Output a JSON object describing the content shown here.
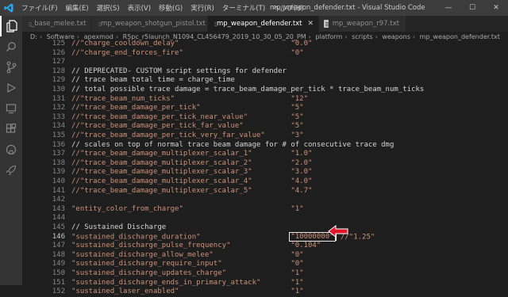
{
  "titlebar": {
    "menus": [
      "ファイル(F)",
      "編集(E)",
      "選択(S)",
      "表示(V)",
      "移動(G)",
      "実行(R)",
      "ターミナル(T)",
      "ヘルプ(H)"
    ],
    "title": "mp_weapon_defender.txt - Visual Studio Code",
    "window_buttons": [
      "—",
      "☐",
      "✕"
    ]
  },
  "activity_bar": {
    "icons": [
      "files-icon",
      "search-icon",
      "source-control-icon",
      "run-debug-icon",
      "remote-explorer-icon",
      "extensions-icon",
      "github-icon",
      "rocket-icon"
    ]
  },
  "tabs": [
    {
      "label": "_base_melee.txt",
      "active": false
    },
    {
      "label": "mp_weapon_shotgun_pistol.txt",
      "active": false
    },
    {
      "label": "mp_weapon_defender.txt",
      "active": true
    },
    {
      "label": "mp_weapon_r97.txt",
      "active": false
    }
  ],
  "breadcrumb": [
    "D:",
    "Software",
    "apexmod",
    "R5pc_r5launch_N1094_CL456479_2019_10_30_05_20_PM",
    "platform",
    "scripts",
    "weapons",
    "mp_weapon_defender.txt"
  ],
  "editor": {
    "lines": [
      {
        "n": "125",
        "code": "//\"charge_cooldown_delay\"                          \"0.0\""
      },
      {
        "n": "126",
        "code": "//\"charge_end_forces_fire\"                         \"0\""
      },
      {
        "n": "127",
        "code": ""
      },
      {
        "n": "128",
        "code": "// DEPRECATED- CUSTOM script settings for defender"
      },
      {
        "n": "129",
        "code": "// trace beam total time = charge_time"
      },
      {
        "n": "130",
        "code": "// total possible trace damage = trace_beam_damage_per_tick * trace_beam_num_ticks"
      },
      {
        "n": "131",
        "code": "//\"trace_beam_num_ticks\"                           \"12\""
      },
      {
        "n": "132",
        "code": "//\"trace_beam_damage_per_tick\"                     \"5\""
      },
      {
        "n": "133",
        "code": "//\"trace_beam_damage_per_tick_near_value\"          \"5\""
      },
      {
        "n": "134",
        "code": "//\"trace_beam_damage_per_tick_far_value\"           \"5\""
      },
      {
        "n": "135",
        "code": "//\"trace_beam_damage_per_tick_very_far_value\"      \"3\""
      },
      {
        "n": "136",
        "code": "// scales on top of normal trace beam damage for # of consecutive trace dmg"
      },
      {
        "n": "137",
        "code": "//\"trace_beam_damage_multiplexer_scalar_1\"         \"1.0\""
      },
      {
        "n": "138",
        "code": "//\"trace_beam_damage_multiplexer_scalar_2\"         \"2.0\""
      },
      {
        "n": "139",
        "code": "//\"trace_beam_damage_multiplexer_scalar_3\"         \"3.0\""
      },
      {
        "n": "140",
        "code": "//\"trace_beam_damage_multiplexer_scalar_4\"         \"4.0\""
      },
      {
        "n": "141",
        "code": "//\"trace_beam_damage_multiplexer_scalar_5\"         \"4.7\""
      },
      {
        "n": "142",
        "code": ""
      },
      {
        "n": "143",
        "code": "\"entity_color_from_charge\"                         \"1\""
      },
      {
        "n": "144",
        "code": ""
      },
      {
        "n": "145",
        "code": "// Sustained Discharge"
      },
      {
        "n": "146",
        "key": "\"sustained_discharge_duration\"                     ",
        "highlight": "\"10000000\"",
        "rest": " //\"1.25\""
      },
      {
        "n": "147",
        "code": "\"sustained_discharge_pulse_frequency\"              \"0.104\""
      },
      {
        "n": "148",
        "code": "\"sustained_discharge_allow_melee\"                  \"0\""
      },
      {
        "n": "149",
        "code": "\"sustained_discharge_require_input\"                \"0\""
      },
      {
        "n": "150",
        "code": "\"sustained_discharge_updates_charge\"               \"1\""
      },
      {
        "n": "151",
        "code": "\"sustained_discharge_ends_in_primary_attack\"       \"1\""
      },
      {
        "n": "152",
        "code": "\"sustained_laser_enabled\"                          \"1\""
      }
    ],
    "current_line": "146"
  },
  "colors": {
    "arrow": "#e0192a",
    "string": "#ce9178",
    "text": "#d4d4d4",
    "linenum": "#858585"
  }
}
